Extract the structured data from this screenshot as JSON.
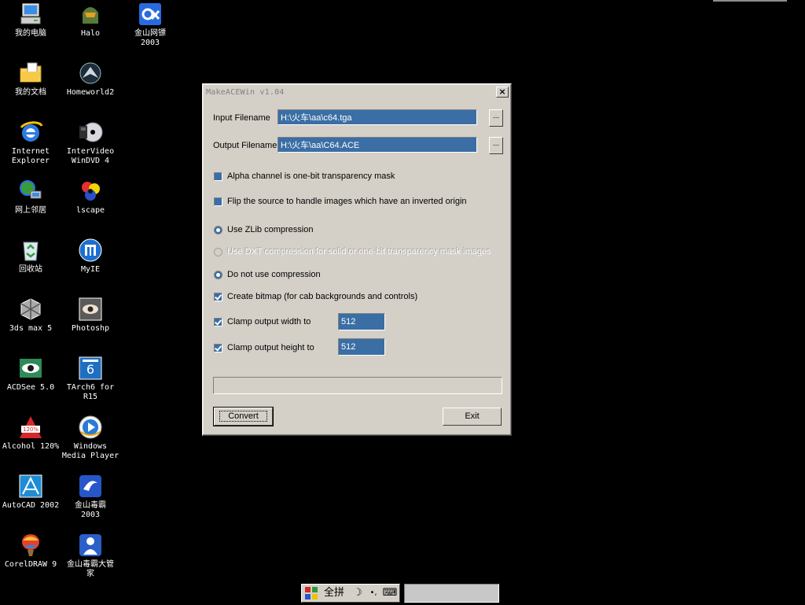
{
  "desktop": {
    "icons": [
      {
        "label": "我的电脑",
        "icon": "my-computer-icon"
      },
      {
        "label": "Halo",
        "icon": "halo-icon"
      },
      {
        "label": "金山网镖\n2003",
        "icon": "kingsoft-firewall-icon"
      },
      {
        "label": "我的文档",
        "icon": "my-documents-icon"
      },
      {
        "label": "Homeworld2",
        "icon": "homeworld2-icon"
      },
      {
        "label": "Internet\nExplorer",
        "icon": "internet-explorer-icon"
      },
      {
        "label": "InterVideo\nWinDVD 4",
        "icon": "windvd-icon"
      },
      {
        "label": "网上邻居",
        "icon": "network-places-icon"
      },
      {
        "label": "lscape",
        "icon": "lscape-icon"
      },
      {
        "label": "回收站",
        "icon": "recycle-bin-icon"
      },
      {
        "label": "MyIE",
        "icon": "myie-icon"
      },
      {
        "label": "3ds max 5",
        "icon": "3dsmax-icon"
      },
      {
        "label": "Photoshp",
        "icon": "photoshop-icon"
      },
      {
        "label": "ACDSee 5.0",
        "icon": "acdsee-icon"
      },
      {
        "label": "TArch6 for\nR15",
        "icon": "tarch-icon"
      },
      {
        "label": "Alcohol 120%",
        "icon": "alcohol-icon"
      },
      {
        "label": "Windows\nMedia Player",
        "icon": "media-player-icon"
      },
      {
        "label": "AutoCAD 2002",
        "icon": "autocad-icon"
      },
      {
        "label": "金山毒霸\n2003",
        "icon": "kingsoft-antivirus-icon"
      },
      {
        "label": "CorelDRAW 9",
        "icon": "coreldraw-icon"
      },
      {
        "label": "金山毒霸大管\n家",
        "icon": "kingsoft-manager-icon"
      }
    ]
  },
  "dialog": {
    "title": "MakeACEWin v1.04",
    "close_glyph": "×",
    "input": {
      "label": "Input Filename",
      "value": "H:\\火车\\aa\\c64.tga",
      "browse_label": "..."
    },
    "output": {
      "label": "Output Filename",
      "value": "H:\\火车\\aa\\C64.ACE",
      "browse_label": "..."
    },
    "options": {
      "alpha_mask": {
        "label": "Alpha channel is one-bit transparency mask",
        "checked": false
      },
      "flip_source": {
        "label": "Flip the source to handle images which have an inverted origin",
        "checked": false
      },
      "zlib": {
        "label": "Use ZLib compression",
        "selected": true
      },
      "dxt": {
        "label": "Use DXT compression for solid or one-bit transparency mask images",
        "selected": false,
        "disabled": true
      },
      "no_compression": {
        "label": "Do not use compression",
        "selected": true
      },
      "create_bitmap": {
        "label": "Create bitmap (for cab backgrounds and controls)",
        "checked": true
      },
      "clamp_width": {
        "label": "Clamp output width to",
        "checked": true,
        "value": "512"
      },
      "clamp_height": {
        "label": "Clamp output height to",
        "checked": true,
        "value": "512"
      }
    },
    "progress": 0,
    "convert_label": "Convert",
    "exit_label": "Exit"
  },
  "ime": {
    "mode_label": "全拼",
    "moon_glyph": "☽",
    "punct_glyph": "•,",
    "keyboard_glyph": "⌨"
  },
  "colors": {
    "desktop_bg": "#000000",
    "dialog_bg": "#d4d0c8",
    "field_bg": "#3a6ea5"
  }
}
